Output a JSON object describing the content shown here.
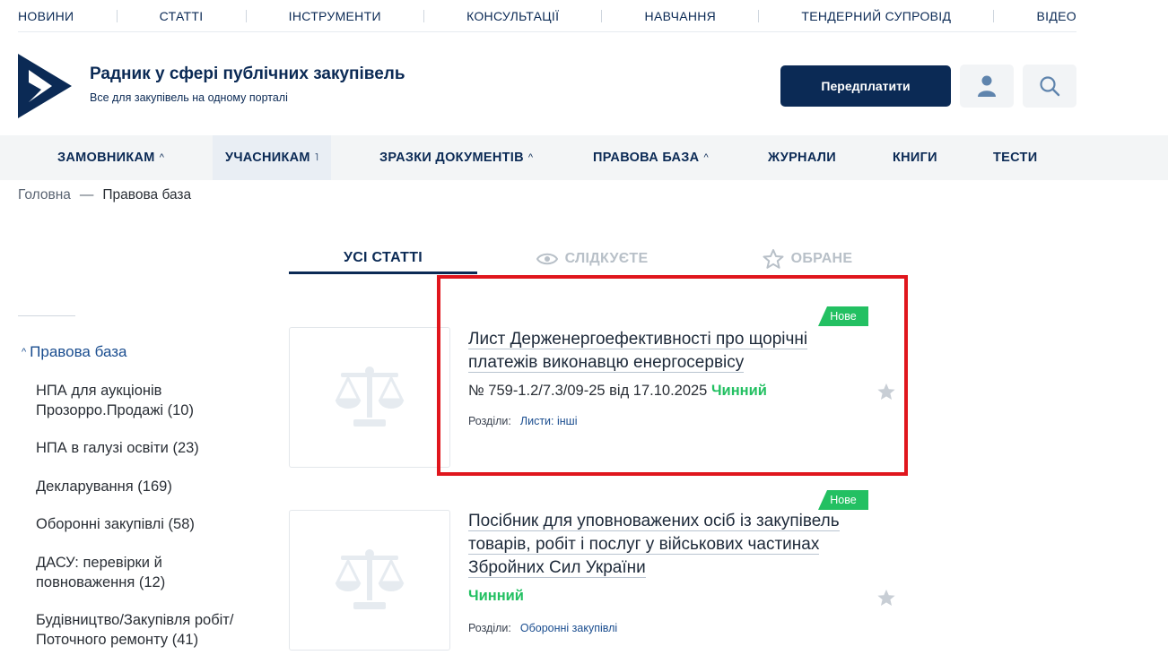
{
  "topnav": [
    "НОВИНИ",
    "СТАТТІ",
    "ІНСТРУМЕНТИ",
    "КОНСУЛЬТАЦІЇ",
    "НАВЧАННЯ",
    "ТЕНДЕРНИЙ СУПРОВІД",
    "ВІДЕО"
  ],
  "header": {
    "title": "Радник у сфері публічних закупівель",
    "subtitle": "Все для закупівель на одному порталі",
    "subscribe_label": "Передплатити"
  },
  "mainnav": [
    "ЗАМОВНИКАМ",
    "УЧАСНИКАМ",
    "ЗРАЗКИ ДОКУМЕНТІВ",
    "ПРАВОВА БАЗА",
    "ЖУРНАЛИ",
    "КНИГИ",
    "ТЕСТИ"
  ],
  "breadcrumb": {
    "home": "Головна",
    "sep": "—",
    "current": "Правова база"
  },
  "tabs": {
    "all": "УСІ СТАТТІ",
    "follow": "СЛІДКУЄТЕ",
    "favorites": "ОБРАНЕ"
  },
  "sidebar": {
    "root": "Правова база",
    "items": [
      "НПА для аукціонів Прозорро.Продажі (10)",
      "НПА в галузі освіти (23)",
      "Декларування (169)",
      "Оборонні закупівлі (58)",
      "ДАСУ: перевірки й повноваження (12)",
      "Будівництво/Закупівля робіт/ Поточного ремонту (41)"
    ]
  },
  "articles": [
    {
      "badge": "Нове",
      "title": "Лист Держенергоефективності про щорічні платежів виконавцю енергосервісу",
      "number": "№ 759-1.2/7.3/09-25 від 17.10.2025",
      "status": "Чинний",
      "sections_label": "Розділи:",
      "sections_value": "Листи: інші"
    },
    {
      "badge": "Нове",
      "title": "Посібник для уповноважених осіб із закупівель товарів, робіт і послуг у військових частинах Збройних Сил України",
      "number": "",
      "status": "Чинний",
      "sections_label": "Розділи:",
      "sections_value": "Оборонні закупівлі"
    }
  ],
  "colors": {
    "brand": "#0b2a55",
    "accent_green": "#23c062",
    "highlight_red": "#e0161d"
  },
  "icons": [
    "logo-icon",
    "user-icon",
    "search-icon",
    "eye-icon",
    "star-icon",
    "scales-icon"
  ]
}
